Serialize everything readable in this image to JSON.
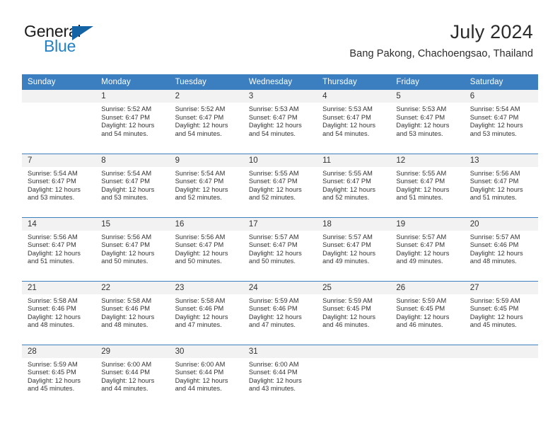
{
  "brand": {
    "word_one": "General",
    "word_two": "Blue",
    "triangle_icon": "triangle-icon",
    "accent_color": "#2581c4"
  },
  "header": {
    "title": "July 2024",
    "subtitle": "Bang Pakong, Chachoengsao, Thailand"
  },
  "calendar": {
    "header_bg": "#3c7fc1",
    "daynum_bg": "#f2f2f2",
    "weekday_headers": [
      "Sunday",
      "Monday",
      "Tuesday",
      "Wednesday",
      "Thursday",
      "Friday",
      "Saturday"
    ],
    "weeks": [
      [
        {
          "day": "",
          "sunrise": "",
          "sunset": "",
          "daylight_1": "",
          "daylight_2": "",
          "empty": true
        },
        {
          "day": "1",
          "sunrise": "Sunrise: 5:52 AM",
          "sunset": "Sunset: 6:47 PM",
          "daylight_1": "Daylight: 12 hours",
          "daylight_2": "and 54 minutes."
        },
        {
          "day": "2",
          "sunrise": "Sunrise: 5:52 AM",
          "sunset": "Sunset: 6:47 PM",
          "daylight_1": "Daylight: 12 hours",
          "daylight_2": "and 54 minutes."
        },
        {
          "day": "3",
          "sunrise": "Sunrise: 5:53 AM",
          "sunset": "Sunset: 6:47 PM",
          "daylight_1": "Daylight: 12 hours",
          "daylight_2": "and 54 minutes."
        },
        {
          "day": "4",
          "sunrise": "Sunrise: 5:53 AM",
          "sunset": "Sunset: 6:47 PM",
          "daylight_1": "Daylight: 12 hours",
          "daylight_2": "and 54 minutes."
        },
        {
          "day": "5",
          "sunrise": "Sunrise: 5:53 AM",
          "sunset": "Sunset: 6:47 PM",
          "daylight_1": "Daylight: 12 hours",
          "daylight_2": "and 53 minutes."
        },
        {
          "day": "6",
          "sunrise": "Sunrise: 5:54 AM",
          "sunset": "Sunset: 6:47 PM",
          "daylight_1": "Daylight: 12 hours",
          "daylight_2": "and 53 minutes."
        }
      ],
      [
        {
          "day": "7",
          "sunrise": "Sunrise: 5:54 AM",
          "sunset": "Sunset: 6:47 PM",
          "daylight_1": "Daylight: 12 hours",
          "daylight_2": "and 53 minutes."
        },
        {
          "day": "8",
          "sunrise": "Sunrise: 5:54 AM",
          "sunset": "Sunset: 6:47 PM",
          "daylight_1": "Daylight: 12 hours",
          "daylight_2": "and 53 minutes."
        },
        {
          "day": "9",
          "sunrise": "Sunrise: 5:54 AM",
          "sunset": "Sunset: 6:47 PM",
          "daylight_1": "Daylight: 12 hours",
          "daylight_2": "and 52 minutes."
        },
        {
          "day": "10",
          "sunrise": "Sunrise: 5:55 AM",
          "sunset": "Sunset: 6:47 PM",
          "daylight_1": "Daylight: 12 hours",
          "daylight_2": "and 52 minutes."
        },
        {
          "day": "11",
          "sunrise": "Sunrise: 5:55 AM",
          "sunset": "Sunset: 6:47 PM",
          "daylight_1": "Daylight: 12 hours",
          "daylight_2": "and 52 minutes."
        },
        {
          "day": "12",
          "sunrise": "Sunrise: 5:55 AM",
          "sunset": "Sunset: 6:47 PM",
          "daylight_1": "Daylight: 12 hours",
          "daylight_2": "and 51 minutes."
        },
        {
          "day": "13",
          "sunrise": "Sunrise: 5:56 AM",
          "sunset": "Sunset: 6:47 PM",
          "daylight_1": "Daylight: 12 hours",
          "daylight_2": "and 51 minutes."
        }
      ],
      [
        {
          "day": "14",
          "sunrise": "Sunrise: 5:56 AM",
          "sunset": "Sunset: 6:47 PM",
          "daylight_1": "Daylight: 12 hours",
          "daylight_2": "and 51 minutes."
        },
        {
          "day": "15",
          "sunrise": "Sunrise: 5:56 AM",
          "sunset": "Sunset: 6:47 PM",
          "daylight_1": "Daylight: 12 hours",
          "daylight_2": "and 50 minutes."
        },
        {
          "day": "16",
          "sunrise": "Sunrise: 5:56 AM",
          "sunset": "Sunset: 6:47 PM",
          "daylight_1": "Daylight: 12 hours",
          "daylight_2": "and 50 minutes."
        },
        {
          "day": "17",
          "sunrise": "Sunrise: 5:57 AM",
          "sunset": "Sunset: 6:47 PM",
          "daylight_1": "Daylight: 12 hours",
          "daylight_2": "and 50 minutes."
        },
        {
          "day": "18",
          "sunrise": "Sunrise: 5:57 AM",
          "sunset": "Sunset: 6:47 PM",
          "daylight_1": "Daylight: 12 hours",
          "daylight_2": "and 49 minutes."
        },
        {
          "day": "19",
          "sunrise": "Sunrise: 5:57 AM",
          "sunset": "Sunset: 6:47 PM",
          "daylight_1": "Daylight: 12 hours",
          "daylight_2": "and 49 minutes."
        },
        {
          "day": "20",
          "sunrise": "Sunrise: 5:57 AM",
          "sunset": "Sunset: 6:46 PM",
          "daylight_1": "Daylight: 12 hours",
          "daylight_2": "and 48 minutes."
        }
      ],
      [
        {
          "day": "21",
          "sunrise": "Sunrise: 5:58 AM",
          "sunset": "Sunset: 6:46 PM",
          "daylight_1": "Daylight: 12 hours",
          "daylight_2": "and 48 minutes."
        },
        {
          "day": "22",
          "sunrise": "Sunrise: 5:58 AM",
          "sunset": "Sunset: 6:46 PM",
          "daylight_1": "Daylight: 12 hours",
          "daylight_2": "and 48 minutes."
        },
        {
          "day": "23",
          "sunrise": "Sunrise: 5:58 AM",
          "sunset": "Sunset: 6:46 PM",
          "daylight_1": "Daylight: 12 hours",
          "daylight_2": "and 47 minutes."
        },
        {
          "day": "24",
          "sunrise": "Sunrise: 5:59 AM",
          "sunset": "Sunset: 6:46 PM",
          "daylight_1": "Daylight: 12 hours",
          "daylight_2": "and 47 minutes."
        },
        {
          "day": "25",
          "sunrise": "Sunrise: 5:59 AM",
          "sunset": "Sunset: 6:45 PM",
          "daylight_1": "Daylight: 12 hours",
          "daylight_2": "and 46 minutes."
        },
        {
          "day": "26",
          "sunrise": "Sunrise: 5:59 AM",
          "sunset": "Sunset: 6:45 PM",
          "daylight_1": "Daylight: 12 hours",
          "daylight_2": "and 46 minutes."
        },
        {
          "day": "27",
          "sunrise": "Sunrise: 5:59 AM",
          "sunset": "Sunset: 6:45 PM",
          "daylight_1": "Daylight: 12 hours",
          "daylight_2": "and 45 minutes."
        }
      ],
      [
        {
          "day": "28",
          "sunrise": "Sunrise: 5:59 AM",
          "sunset": "Sunset: 6:45 PM",
          "daylight_1": "Daylight: 12 hours",
          "daylight_2": "and 45 minutes."
        },
        {
          "day": "29",
          "sunrise": "Sunrise: 6:00 AM",
          "sunset": "Sunset: 6:44 PM",
          "daylight_1": "Daylight: 12 hours",
          "daylight_2": "and 44 minutes."
        },
        {
          "day": "30",
          "sunrise": "Sunrise: 6:00 AM",
          "sunset": "Sunset: 6:44 PM",
          "daylight_1": "Daylight: 12 hours",
          "daylight_2": "and 44 minutes."
        },
        {
          "day": "31",
          "sunrise": "Sunrise: 6:00 AM",
          "sunset": "Sunset: 6:44 PM",
          "daylight_1": "Daylight: 12 hours",
          "daylight_2": "and 43 minutes."
        },
        {
          "day": "",
          "sunrise": "",
          "sunset": "",
          "daylight_1": "",
          "daylight_2": "",
          "empty": true
        },
        {
          "day": "",
          "sunrise": "",
          "sunset": "",
          "daylight_1": "",
          "daylight_2": "",
          "empty": true
        },
        {
          "day": "",
          "sunrise": "",
          "sunset": "",
          "daylight_1": "",
          "daylight_2": "",
          "empty": true
        }
      ]
    ]
  }
}
